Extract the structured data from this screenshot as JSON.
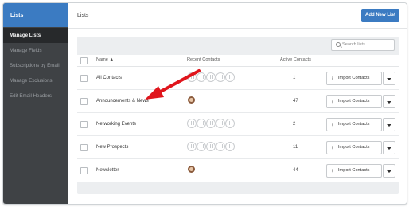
{
  "sidebar": {
    "header": "Lists",
    "items": [
      {
        "label": "Manage Lists",
        "active": true
      },
      {
        "label": "Manage Fields",
        "active": false
      },
      {
        "label": "Subscriptions by Email",
        "active": false
      },
      {
        "label": "Manage Exclusions",
        "active": false
      },
      {
        "label": "Edit Email Headers",
        "active": false
      }
    ]
  },
  "header": {
    "title": "Lists",
    "add_button": "Add New List"
  },
  "search": {
    "placeholder": "Search lists..."
  },
  "table": {
    "columns": {
      "name": "Name ▲",
      "recent": "Recent Contacts",
      "active": "Active Contacts"
    },
    "rows": [
      {
        "name": "All Contacts",
        "recent": "empty",
        "active": "1",
        "action": "Import Contacts"
      },
      {
        "name": "Announcements & News",
        "recent": "avatar",
        "active": "47",
        "action": "Import Contacts"
      },
      {
        "name": "Networking Events",
        "recent": "empty",
        "active": "2",
        "action": "Import Contacts"
      },
      {
        "name": "New Prospects",
        "recent": "empty",
        "active": "11",
        "action": "Import Contacts"
      },
      {
        "name": "Newsletter",
        "recent": "avatar",
        "active": "44",
        "action": "Import Contacts"
      }
    ]
  },
  "icons": {
    "search": "search-icon",
    "import": "download-arrow-icon",
    "dropdown": "chevron-down-icon",
    "annotation": "red-arrow-annotation"
  },
  "colors": {
    "accent": "#3b7bc2",
    "sidebar": "#3f4245",
    "sidebar_active": "#27292b",
    "annotation": "#e0151c"
  }
}
